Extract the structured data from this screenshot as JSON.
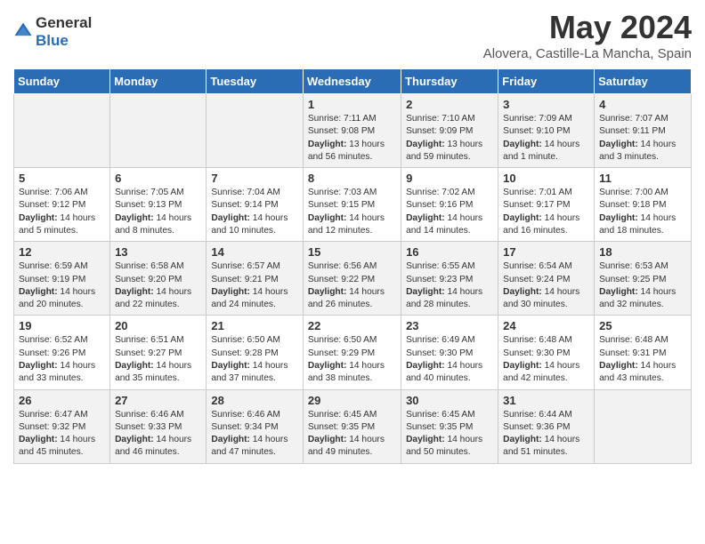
{
  "logo": {
    "general": "General",
    "blue": "Blue"
  },
  "title": "May 2024",
  "location": "Alovera, Castille-La Mancha, Spain",
  "headers": [
    "Sunday",
    "Monday",
    "Tuesday",
    "Wednesday",
    "Thursday",
    "Friday",
    "Saturday"
  ],
  "weeks": [
    [
      {
        "day": "",
        "info": ""
      },
      {
        "day": "",
        "info": ""
      },
      {
        "day": "",
        "info": ""
      },
      {
        "day": "1",
        "info": "Sunrise: 7:11 AM\nSunset: 9:08 PM\nDaylight: 13 hours and 56 minutes."
      },
      {
        "day": "2",
        "info": "Sunrise: 7:10 AM\nSunset: 9:09 PM\nDaylight: 13 hours and 59 minutes."
      },
      {
        "day": "3",
        "info": "Sunrise: 7:09 AM\nSunset: 9:10 PM\nDaylight: 14 hours and 1 minute."
      },
      {
        "day": "4",
        "info": "Sunrise: 7:07 AM\nSunset: 9:11 PM\nDaylight: 14 hours and 3 minutes."
      }
    ],
    [
      {
        "day": "5",
        "info": "Sunrise: 7:06 AM\nSunset: 9:12 PM\nDaylight: 14 hours and 5 minutes."
      },
      {
        "day": "6",
        "info": "Sunrise: 7:05 AM\nSunset: 9:13 PM\nDaylight: 14 hours and 8 minutes."
      },
      {
        "day": "7",
        "info": "Sunrise: 7:04 AM\nSunset: 9:14 PM\nDaylight: 14 hours and 10 minutes."
      },
      {
        "day": "8",
        "info": "Sunrise: 7:03 AM\nSunset: 9:15 PM\nDaylight: 14 hours and 12 minutes."
      },
      {
        "day": "9",
        "info": "Sunrise: 7:02 AM\nSunset: 9:16 PM\nDaylight: 14 hours and 14 minutes."
      },
      {
        "day": "10",
        "info": "Sunrise: 7:01 AM\nSunset: 9:17 PM\nDaylight: 14 hours and 16 minutes."
      },
      {
        "day": "11",
        "info": "Sunrise: 7:00 AM\nSunset: 9:18 PM\nDaylight: 14 hours and 18 minutes."
      }
    ],
    [
      {
        "day": "12",
        "info": "Sunrise: 6:59 AM\nSunset: 9:19 PM\nDaylight: 14 hours and 20 minutes."
      },
      {
        "day": "13",
        "info": "Sunrise: 6:58 AM\nSunset: 9:20 PM\nDaylight: 14 hours and 22 minutes."
      },
      {
        "day": "14",
        "info": "Sunrise: 6:57 AM\nSunset: 9:21 PM\nDaylight: 14 hours and 24 minutes."
      },
      {
        "day": "15",
        "info": "Sunrise: 6:56 AM\nSunset: 9:22 PM\nDaylight: 14 hours and 26 minutes."
      },
      {
        "day": "16",
        "info": "Sunrise: 6:55 AM\nSunset: 9:23 PM\nDaylight: 14 hours and 28 minutes."
      },
      {
        "day": "17",
        "info": "Sunrise: 6:54 AM\nSunset: 9:24 PM\nDaylight: 14 hours and 30 minutes."
      },
      {
        "day": "18",
        "info": "Sunrise: 6:53 AM\nSunset: 9:25 PM\nDaylight: 14 hours and 32 minutes."
      }
    ],
    [
      {
        "day": "19",
        "info": "Sunrise: 6:52 AM\nSunset: 9:26 PM\nDaylight: 14 hours and 33 minutes."
      },
      {
        "day": "20",
        "info": "Sunrise: 6:51 AM\nSunset: 9:27 PM\nDaylight: 14 hours and 35 minutes."
      },
      {
        "day": "21",
        "info": "Sunrise: 6:50 AM\nSunset: 9:28 PM\nDaylight: 14 hours and 37 minutes."
      },
      {
        "day": "22",
        "info": "Sunrise: 6:50 AM\nSunset: 9:29 PM\nDaylight: 14 hours and 38 minutes."
      },
      {
        "day": "23",
        "info": "Sunrise: 6:49 AM\nSunset: 9:30 PM\nDaylight: 14 hours and 40 minutes."
      },
      {
        "day": "24",
        "info": "Sunrise: 6:48 AM\nSunset: 9:30 PM\nDaylight: 14 hours and 42 minutes."
      },
      {
        "day": "25",
        "info": "Sunrise: 6:48 AM\nSunset: 9:31 PM\nDaylight: 14 hours and 43 minutes."
      }
    ],
    [
      {
        "day": "26",
        "info": "Sunrise: 6:47 AM\nSunset: 9:32 PM\nDaylight: 14 hours and 45 minutes."
      },
      {
        "day": "27",
        "info": "Sunrise: 6:46 AM\nSunset: 9:33 PM\nDaylight: 14 hours and 46 minutes."
      },
      {
        "day": "28",
        "info": "Sunrise: 6:46 AM\nSunset: 9:34 PM\nDaylight: 14 hours and 47 minutes."
      },
      {
        "day": "29",
        "info": "Sunrise: 6:45 AM\nSunset: 9:35 PM\nDaylight: 14 hours and 49 minutes."
      },
      {
        "day": "30",
        "info": "Sunrise: 6:45 AM\nSunset: 9:35 PM\nDaylight: 14 hours and 50 minutes."
      },
      {
        "day": "31",
        "info": "Sunrise: 6:44 AM\nSunset: 9:36 PM\nDaylight: 14 hours and 51 minutes."
      },
      {
        "day": "",
        "info": ""
      }
    ]
  ]
}
